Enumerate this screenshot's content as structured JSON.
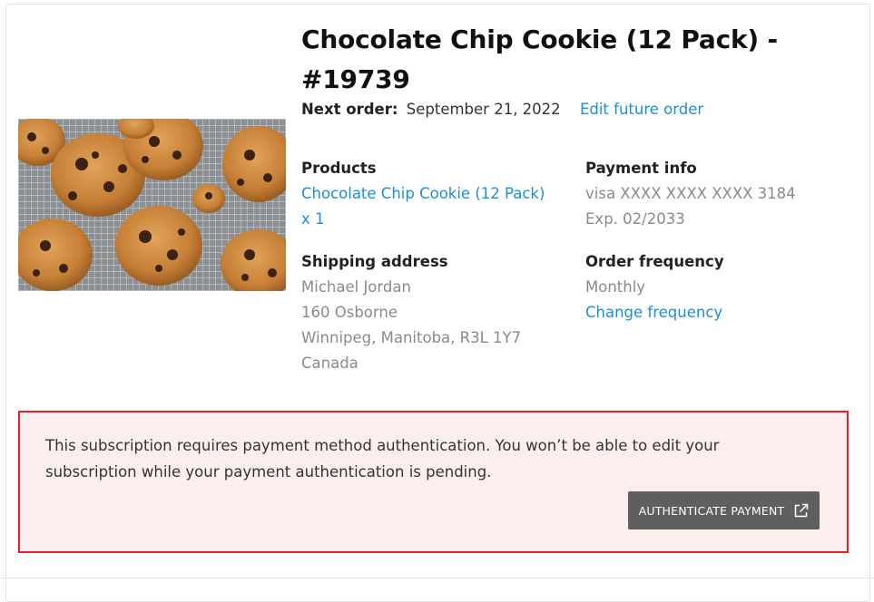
{
  "subscription": {
    "title": "Chocolate Chip Cookie (12 Pack) - #19739",
    "next_order_label": "Next order:",
    "next_order_date": "September 21, 2022",
    "edit_link": "Edit future order",
    "image_alt": "cookies-photo"
  },
  "products": {
    "heading": "Products",
    "item_link": "Chocolate Chip Cookie (12 Pack)",
    "quantity": "x 1"
  },
  "payment": {
    "heading": "Payment info",
    "card": "visa XXXX XXXX XXXX 3184",
    "expiry": "Exp. 02/2033"
  },
  "shipping": {
    "heading": "Shipping address",
    "name": "Michael Jordan",
    "street": "160 Osborne",
    "city": "Winnipeg, Manitoba, R3L 1Y7",
    "country": "Canada"
  },
  "frequency": {
    "heading": "Order frequency",
    "value": "Monthly",
    "change_link": "Change frequency"
  },
  "alert": {
    "message": "This subscription requires payment method authentication. You won’t be able to edit your subscription while your payment authentication is pending.",
    "button_label": "AUTHENTICATE PAYMENT",
    "button_icon": "external-link-icon",
    "border_color": "#e8202b",
    "background_color": "#fdeeee"
  },
  "colors": {
    "link": "#1a8fd8",
    "muted": "#8a8a8a",
    "button": "#5f5f5f"
  }
}
